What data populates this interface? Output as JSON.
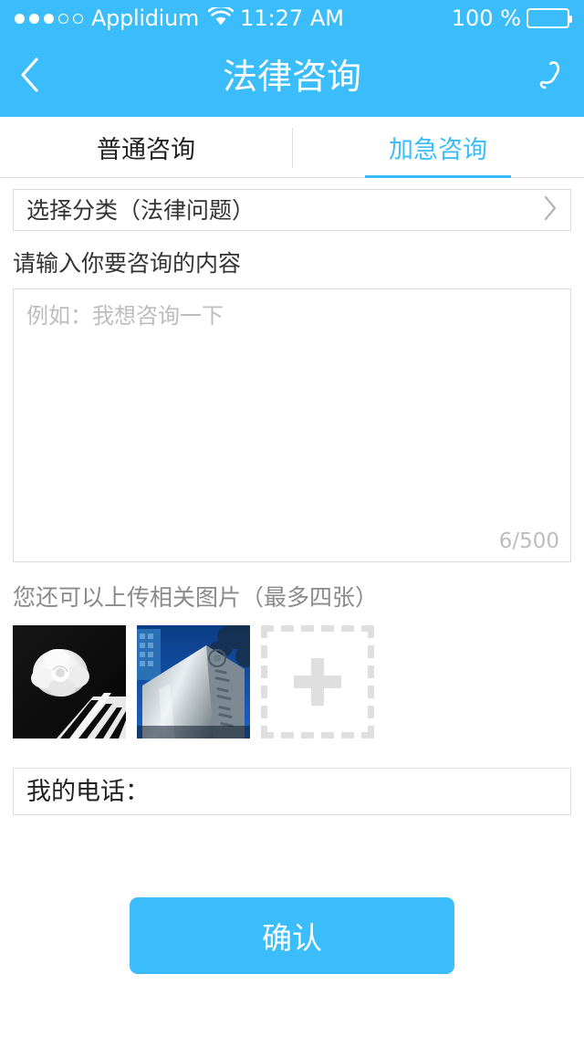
{
  "theme": {
    "accent": "#3cbdfb",
    "text_primary": "#222222",
    "text_muted": "#8a8a8a",
    "placeholder": "#bdbdbd",
    "border": "#dcdcdc"
  },
  "status_bar": {
    "carrier": "Applidium",
    "time": "11:27 AM",
    "battery_percent": "100 %",
    "signal_dots_filled": 3,
    "signal_dots_total": 5,
    "wifi_icon": "wifi-icon",
    "battery_icon": "battery-icon"
  },
  "nav": {
    "title": "法律咨询",
    "back_icon": "chevron-left-icon",
    "phone_icon": "phone-icon"
  },
  "tabs": [
    {
      "label": "普通咨询",
      "active": false
    },
    {
      "label": "加急咨询",
      "active": true
    }
  ],
  "form": {
    "category": {
      "label": "选择分类（法律问题）",
      "chevron_icon": "chevron-right-icon"
    },
    "content": {
      "field_label": "请输入你要咨询的内容",
      "placeholder": "例如：我想咨询一下",
      "value": "",
      "char_count": "6/500",
      "max_length": 500
    },
    "upload": {
      "label": "您还可以上传相关图片（最多四张）",
      "max_photos": 4,
      "photos": [
        {
          "alt": "白玫瑰与钢琴键",
          "name": "photo-thumbnail-rose-piano"
        },
        {
          "alt": "大学校门石碑",
          "name": "photo-thumbnail-building-sign"
        }
      ],
      "add_icon": "plus-icon"
    },
    "phone": {
      "label": "我的电话：",
      "value": "",
      "placeholder": ""
    },
    "submit": {
      "label": "确认"
    }
  }
}
